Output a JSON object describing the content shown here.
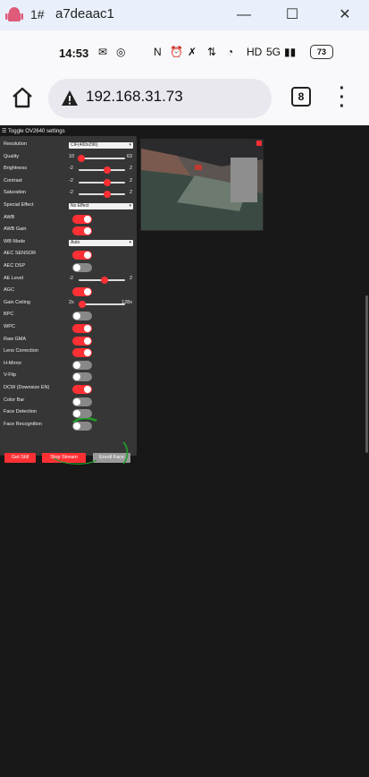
{
  "window": {
    "title_prefix": "1#",
    "title": "a7deaac1",
    "minimize_icon": "minimize-icon",
    "maximize_icon": "maximize-icon",
    "close_icon": "close-icon"
  },
  "status_bar": {
    "time": "14:53",
    "network": "5G",
    "battery": "73"
  },
  "browser": {
    "url": "192.168.31.73",
    "tab_count": "8"
  },
  "camera": {
    "toggle_label": "Toggle OV2640 settings",
    "controls": [
      {
        "label": "Resolution",
        "type": "select",
        "value": "CIF(400x296)"
      },
      {
        "label": "Quality",
        "type": "range",
        "min": "10",
        "max": "63",
        "level": 0.05
      },
      {
        "label": "Brightness",
        "type": "range",
        "min": "-2",
        "max": "2",
        "level": 0.62
      },
      {
        "label": "Contrast",
        "type": "range",
        "min": "-2",
        "max": "2",
        "level": 0.62
      },
      {
        "label": "Saturation",
        "type": "range",
        "min": "-2",
        "max": "2",
        "level": 0.62
      },
      {
        "label": "Special Effect",
        "type": "select",
        "value": "No Effect"
      },
      {
        "label": "AWB",
        "type": "toggle",
        "on": true
      },
      {
        "label": "AWB Gain",
        "type": "toggle",
        "on": true
      },
      {
        "label": "WB Mode",
        "type": "select",
        "value": "Auto"
      },
      {
        "label": "AEC SENSOR",
        "type": "toggle",
        "on": true
      },
      {
        "label": "AEC DSP",
        "type": "toggle",
        "on": false
      },
      {
        "label": "AE Level",
        "type": "range",
        "min": "-2",
        "max": "2",
        "level": 0.55
      },
      {
        "label": "AGC",
        "type": "toggle",
        "on": true
      },
      {
        "label": "Gain Ceiling",
        "type": "range",
        "min": "2x",
        "max": "128x",
        "level": 0.08
      },
      {
        "label": "BPC",
        "type": "toggle",
        "on": false
      },
      {
        "label": "WPC",
        "type": "toggle",
        "on": true
      },
      {
        "label": "Raw GMA",
        "type": "toggle",
        "on": true
      },
      {
        "label": "Lens Correction",
        "type": "toggle",
        "on": true
      },
      {
        "label": "H-Mirror",
        "type": "toggle",
        "on": false
      },
      {
        "label": "V-Flip",
        "type": "toggle",
        "on": false
      },
      {
        "label": "DCW (Downsize EN)",
        "type": "toggle",
        "on": true
      },
      {
        "label": "Color Bar",
        "type": "toggle",
        "on": false
      },
      {
        "label": "Face Detection",
        "type": "toggle",
        "on": false
      },
      {
        "label": "Face Recognition",
        "type": "toggle",
        "on": false
      }
    ],
    "buttons": {
      "get_still": "Get Still",
      "stop_stream": "Stop Stream",
      "enroll_face": "Enroll Face"
    },
    "accent_color": "#ff3034"
  }
}
